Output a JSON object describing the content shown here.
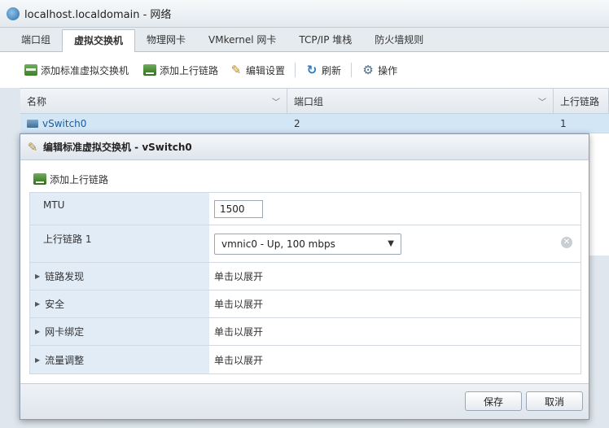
{
  "window": {
    "title": "localhost.localdomain - 网络"
  },
  "tabs": [
    {
      "label": "端口组"
    },
    {
      "label": "虚拟交换机"
    },
    {
      "label": "物理网卡"
    },
    {
      "label": "VMkernel 网卡"
    },
    {
      "label": "TCP/IP 堆栈"
    },
    {
      "label": "防火墙规则"
    }
  ],
  "toolbar": {
    "add_switch": "添加标准虚拟交换机",
    "add_uplink": "添加上行链路",
    "edit_settings": "编辑设置",
    "refresh": "刷新",
    "actions": "操作"
  },
  "table": {
    "columns": [
      "名称",
      "端口组",
      "上行链路"
    ],
    "rows": [
      {
        "name": "vSwitch0",
        "port_groups": "2",
        "uplinks": "1"
      }
    ]
  },
  "dialog": {
    "title": "编辑标准虚拟交换机 - vSwitch0",
    "add_uplink": "添加上行链路",
    "mtu_label": "MTU",
    "mtu_value": "1500",
    "uplink_label": "上行链路 1",
    "uplink_value": "vmnic0 - Up, 100 mbps",
    "sections": [
      {
        "label": "链路发现",
        "value": "单击以展开"
      },
      {
        "label": "安全",
        "value": "单击以展开"
      },
      {
        "label": "网卡绑定",
        "value": "单击以展开"
      },
      {
        "label": "流量调整",
        "value": "单击以展开"
      }
    ],
    "save": "保存",
    "cancel": "取消"
  }
}
